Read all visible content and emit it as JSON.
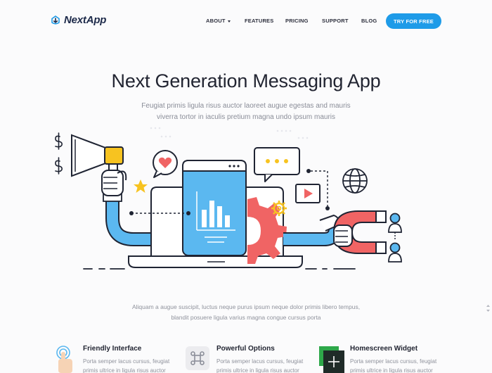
{
  "brand": {
    "name": "NextApp"
  },
  "nav": {
    "items": [
      {
        "label": "ABOUT",
        "has_dropdown": true
      },
      {
        "label": "FEATURES"
      },
      {
        "label": "PRICING"
      },
      {
        "label": "SUPPORT"
      },
      {
        "label": "BLOG"
      }
    ],
    "cta_label": "TRY FOR FREE"
  },
  "hero": {
    "title": "Next Generation Messaging App",
    "subtitle": "Feugiat primis ligula risus auctor laoreet augue egestas and mauris viverra tortor in iaculis pretium magna undo ipsum mauris"
  },
  "intro": {
    "text": "Aliquam a augue suscipit, luctus neque purus ipsum neque dolor primis libero tempus, blandit posuere ligula varius magna congue cursus porta"
  },
  "features": [
    {
      "title": "Friendly Interface",
      "text_line1": "Porta semper lacus cursus, feugiat",
      "text_line2": "primis ultrice in ligula risus auctor",
      "icon": "touch-hand-icon"
    },
    {
      "title": "Powerful Options",
      "text_line1": "Porta semper lacus cursus, feugiat",
      "text_line2": "primis ultrice in ligula risus auctor",
      "icon": "command-key-icon"
    },
    {
      "title": "Homescreen Widget",
      "text_line1": "Porta semper lacus cursus, feugiat",
      "text_line2": "primis ultrice in ligula risus auctor",
      "icon": "widget-plus-icon"
    }
  ],
  "colors": {
    "accent": "#1e9be8",
    "yellow": "#f7c320",
    "red": "#f06464",
    "light_blue": "#5bb8f0",
    "outline": "#1f2433"
  }
}
